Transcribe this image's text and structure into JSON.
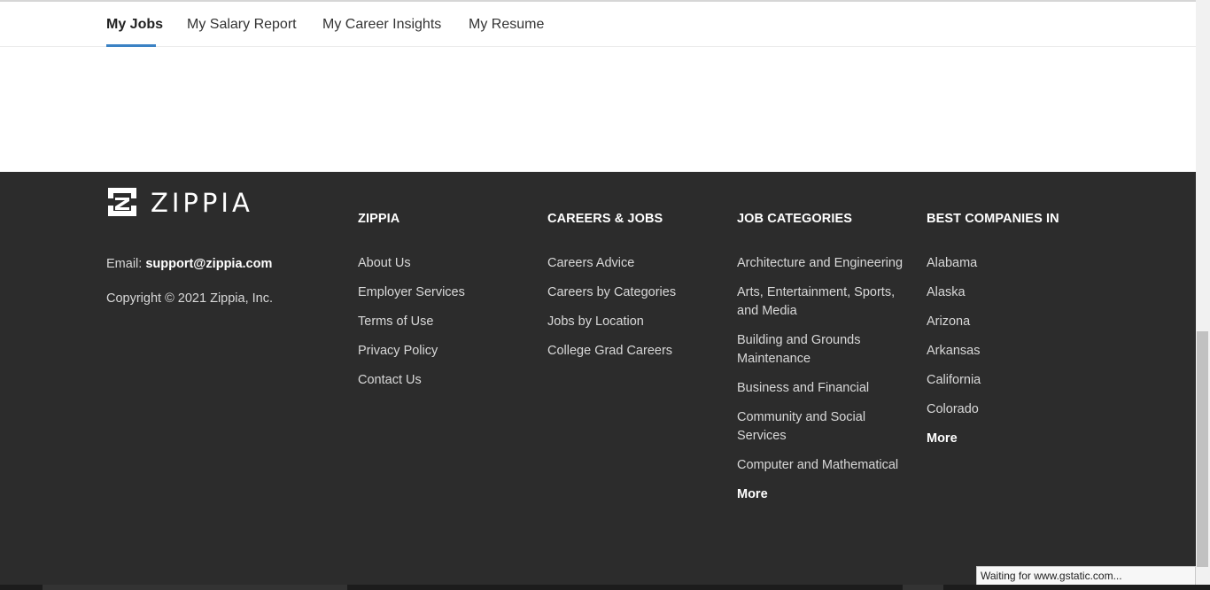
{
  "nav": {
    "tabs": [
      {
        "label": "My Jobs",
        "active": true
      },
      {
        "label": "My Salary Report",
        "active": false
      },
      {
        "label": "My Career Insights",
        "active": false
      },
      {
        "label": "My Resume",
        "active": false
      }
    ],
    "active_color": "#3b82c4"
  },
  "footer": {
    "background": "#2c2c2c",
    "logo_text": "ZIPPIA",
    "email_label": "Email:",
    "email": "support@zippia.com",
    "copyright": "Copyright © 2021 Zippia, Inc.",
    "columns": [
      {
        "title": "ZIPPIA",
        "items": [
          "About Us",
          "Employer Services",
          "Terms of Use",
          "Privacy Policy",
          "Contact Us"
        ]
      },
      {
        "title": "CAREERS & JOBS",
        "items": [
          "Careers Advice",
          "Careers by Categories",
          "Jobs by Location",
          "College Grad Careers"
        ]
      },
      {
        "title": "JOB CATEGORIES",
        "items": [
          "Architecture and Engineering",
          "Arts, Entertainment, Sports, and Media",
          "Building and Grounds Maintenance",
          "Business and Financial",
          "Community and Social Services",
          "Computer and Mathematical"
        ],
        "more": "More"
      },
      {
        "title": "BEST COMPANIES IN",
        "items": [
          "Alabama",
          "Alaska",
          "Arizona",
          "Arkansas",
          "California",
          "Colorado"
        ],
        "more": "More"
      }
    ]
  },
  "status_bar": {
    "text": "Waiting for www.gstatic.com..."
  }
}
